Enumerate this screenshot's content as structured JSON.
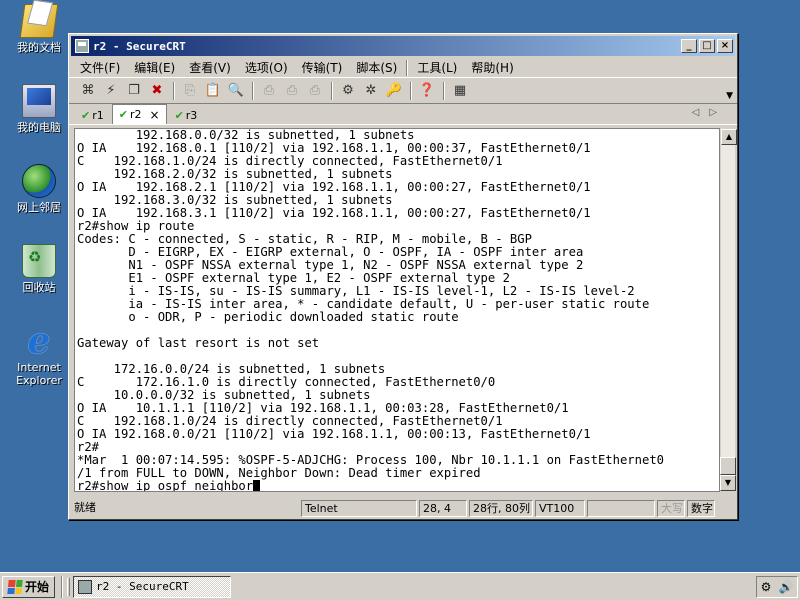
{
  "desktop": {
    "icons": [
      {
        "label": "我的文档",
        "icon": "my-documents-icon"
      },
      {
        "label": "我的电脑",
        "icon": "my-computer-icon"
      },
      {
        "label": "网上邻居",
        "icon": "network-places-icon"
      },
      {
        "label": "回收站",
        "icon": "recycle-bin-icon"
      },
      {
        "label_line1": "Internet",
        "label_line2": "Explorer",
        "icon": "internet-explorer-icon"
      }
    ]
  },
  "window": {
    "title": "r2 - SecureCRT",
    "controls": {
      "minimize": "_",
      "maximize": "□",
      "close": "×"
    }
  },
  "menu": [
    "文件(F)",
    "编辑(E)",
    "查看(V)",
    "选项(O)",
    "传输(T)",
    "脚本(S)",
    "工具(L)",
    "帮助(H)"
  ],
  "toolbar": {
    "icons": [
      "connect-icon",
      "quick-connect-icon",
      "connect-in-tab-icon",
      "disconnect-icon",
      "copy-icon",
      "paste-icon",
      "find-icon",
      "print-icon",
      "print-selection-icon",
      "print-setup-icon",
      "session-options-icon",
      "global-options-icon",
      "keymap-icon",
      "help-icon",
      "screen-icon"
    ]
  },
  "tabs": [
    {
      "label": "r1",
      "active": false
    },
    {
      "label": "r2",
      "active": true,
      "close": "×"
    },
    {
      "label": "r3",
      "active": false
    }
  ],
  "terminal": {
    "lines": [
      "        192.168.0.0/32 is subnetted, 1 subnets",
      "O IA    192.168.0.1 [110/2] via 192.168.1.1, 00:00:37, FastEthernet0/1",
      "C    192.168.1.0/24 is directly connected, FastEthernet0/1",
      "     192.168.2.0/32 is subnetted, 1 subnets",
      "O IA    192.168.2.1 [110/2] via 192.168.1.1, 00:00:27, FastEthernet0/1",
      "     192.168.3.0/32 is subnetted, 1 subnets",
      "O IA    192.168.3.1 [110/2] via 192.168.1.1, 00:00:27, FastEthernet0/1",
      "r2#show ip route",
      "Codes: C - connected, S - static, R - RIP, M - mobile, B - BGP",
      "       D - EIGRP, EX - EIGRP external, O - OSPF, IA - OSPF inter area",
      "       N1 - OSPF NSSA external type 1, N2 - OSPF NSSA external type 2",
      "       E1 - OSPF external type 1, E2 - OSPF external type 2",
      "       i - IS-IS, su - IS-IS summary, L1 - IS-IS level-1, L2 - IS-IS level-2",
      "       ia - IS-IS inter area, * - candidate default, U - per-user static route",
      "       o - ODR, P - periodic downloaded static route",
      "",
      "Gateway of last resort is not set",
      "",
      "     172.16.0.0/24 is subnetted, 1 subnets",
      "C       172.16.1.0 is directly connected, FastEthernet0/0",
      "     10.0.0.0/32 is subnetted, 1 subnets",
      "O IA    10.1.1.1 [110/2] via 192.168.1.1, 00:03:28, FastEthernet0/1",
      "C    192.168.1.0/24 is directly connected, FastEthernet0/1",
      "O IA 192.168.0.0/21 [110/2] via 192.168.1.1, 00:00:13, FastEthernet0/1",
      "r2#",
      "*Mar  1 00:07:14.595: %OSPF-5-ADJCHG: Process 100, Nbr 10.1.1.1 on FastEthernet0",
      "/1 from FULL to DOWN, Neighbor Down: Dead timer expired"
    ],
    "prompt_line": "r2#show ip ospf neighbor"
  },
  "status": {
    "ready": "就绪",
    "protocol": "Telnet",
    "cursor_pos": "28,  4",
    "dimensions": "28行, 80列",
    "emulation": "VT100",
    "caps": "大写",
    "num": "数字"
  },
  "taskbar": {
    "start_label": "开始",
    "task_label": "r2 - SecureCRT"
  }
}
